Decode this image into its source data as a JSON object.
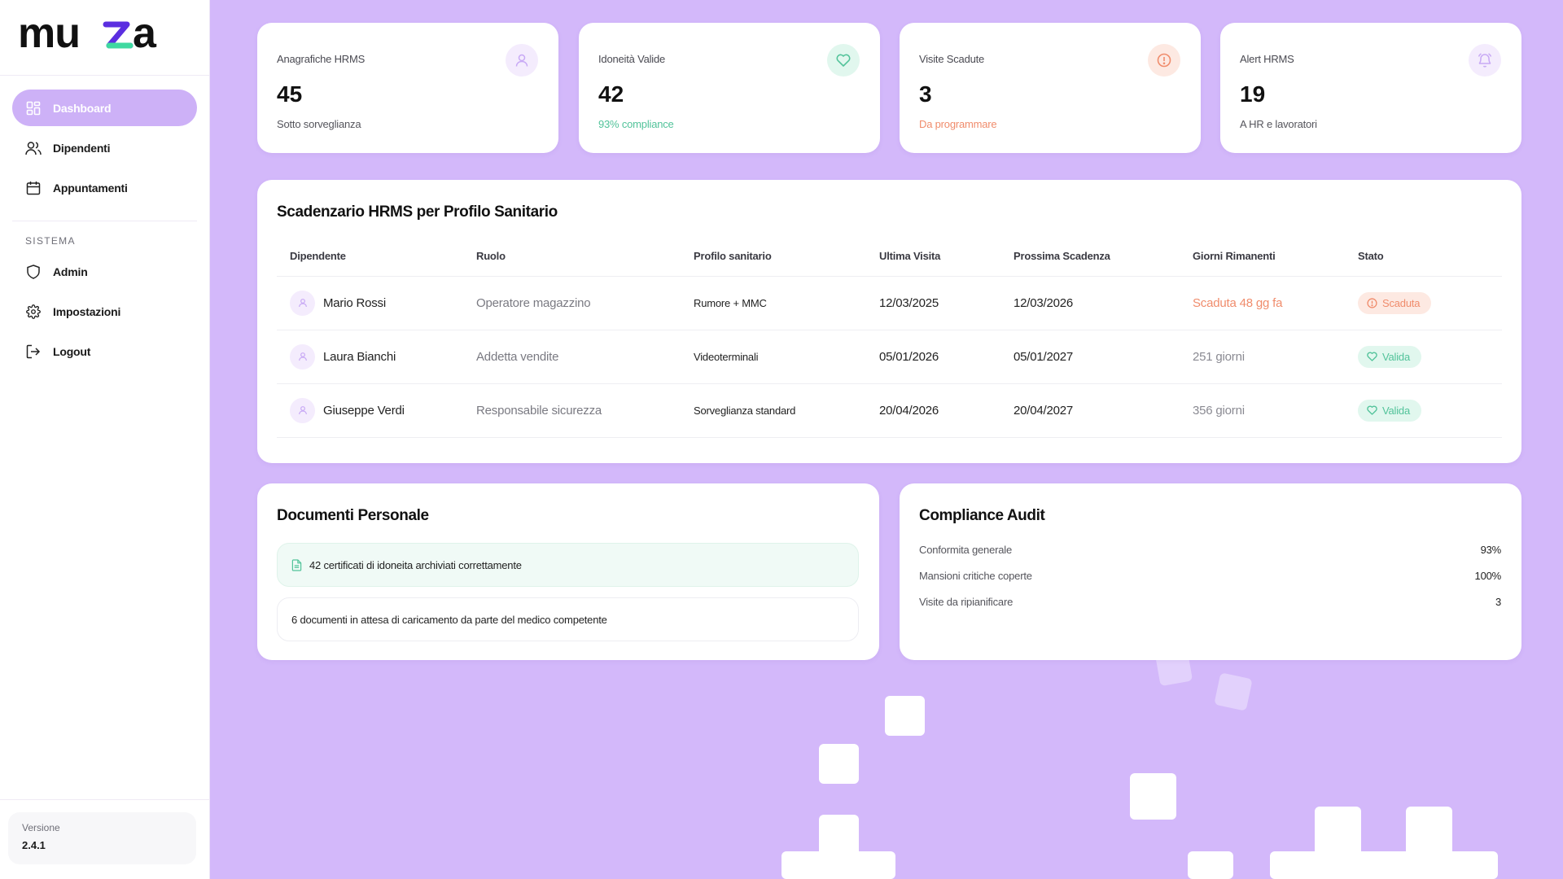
{
  "app": {
    "logo_text": "muza"
  },
  "sidebar": {
    "nav": [
      {
        "label": "Dashboard",
        "icon": "dashboard-grid-icon",
        "active": true
      },
      {
        "label": "Dipendenti",
        "icon": "users-icon"
      },
      {
        "label": "Appuntamenti",
        "icon": "calendar-icon"
      }
    ],
    "section_label": "SISTEMA",
    "system": [
      {
        "label": "Admin",
        "icon": "shield-icon"
      },
      {
        "label": "Impostazioni",
        "icon": "gear-icon"
      },
      {
        "label": "Logout",
        "icon": "logout-icon"
      }
    ],
    "version_label": "Versione",
    "version_value": "2.4.1"
  },
  "stats": [
    {
      "title": "Anagrafiche HRMS",
      "value": "45",
      "sub": "Sotto sorveglianza",
      "icon": "user-icon",
      "sub_color": "#55555c",
      "icon_bg": "#f4ecfd",
      "icon_color": "#c8a9f5"
    },
    {
      "title": "Idoneità Valide",
      "value": "42",
      "sub": "93% compliance",
      "icon": "heart-icon",
      "sub_color": "#52c39a",
      "icon_bg": "#e1f7ee",
      "icon_color": "#52c39a"
    },
    {
      "title": "Visite Scadute",
      "value": "3",
      "sub": "Da programmare",
      "icon": "alert-circle-icon",
      "sub_color": "#f08c6c",
      "icon_bg": "#fde9e2",
      "icon_color": "#f08c6c"
    },
    {
      "title": "Alert HRMS",
      "value": "19",
      "sub": "A HR e lavoratori",
      "icon": "bell-icon",
      "sub_color": "#55555c",
      "icon_bg": "#f4ecfd",
      "icon_color": "#c8a9f5"
    }
  ],
  "schedule": {
    "title": "Scadenzario HRMS per Profilo Sanitario",
    "columns": [
      "Dipendente",
      "Ruolo",
      "Profilo sanitario",
      "Ultima Visita",
      "Prossima Scadenza",
      "Giorni Rimanenti",
      "Stato"
    ],
    "rows": [
      {
        "name": "Mario Rossi",
        "role": "Operatore magazzino",
        "profile": "Rumore + MMC",
        "last": "12/03/2025",
        "next": "12/03/2026",
        "days": "Scaduta 48 gg fa",
        "status": "Scaduta",
        "status_type": "expired"
      },
      {
        "name": "Laura Bianchi",
        "role": "Addetta vendite",
        "profile": "Videoterminali",
        "last": "05/01/2026",
        "next": "05/01/2027",
        "days": "251 giorni",
        "status": "Valida",
        "status_type": "valid"
      },
      {
        "name": "Giuseppe Verdi",
        "role": "Responsabile sicurezza",
        "profile": "Sorveglianza standard",
        "last": "20/04/2026",
        "next": "20/04/2027",
        "days": "356 giorni",
        "status": "Valida",
        "status_type": "valid"
      }
    ]
  },
  "documents": {
    "title": "Documenti Personale",
    "ok_text": "42 certificati di idoneita archiviati correttamente",
    "pending_text": "6 documenti in attesa di caricamento da parte del medico competente"
  },
  "audit": {
    "title": "Compliance Audit",
    "rows": [
      {
        "label": "Conformita generale",
        "value": "93%"
      },
      {
        "label": "Mansioni critiche coperte",
        "value": "100%"
      },
      {
        "label": "Visite da ripianificare",
        "value": "3"
      }
    ]
  },
  "colors": {
    "accent": "#cdb1f7",
    "background": "#d3b8fa",
    "success": "#52c39a",
    "danger": "#f08c6c"
  }
}
